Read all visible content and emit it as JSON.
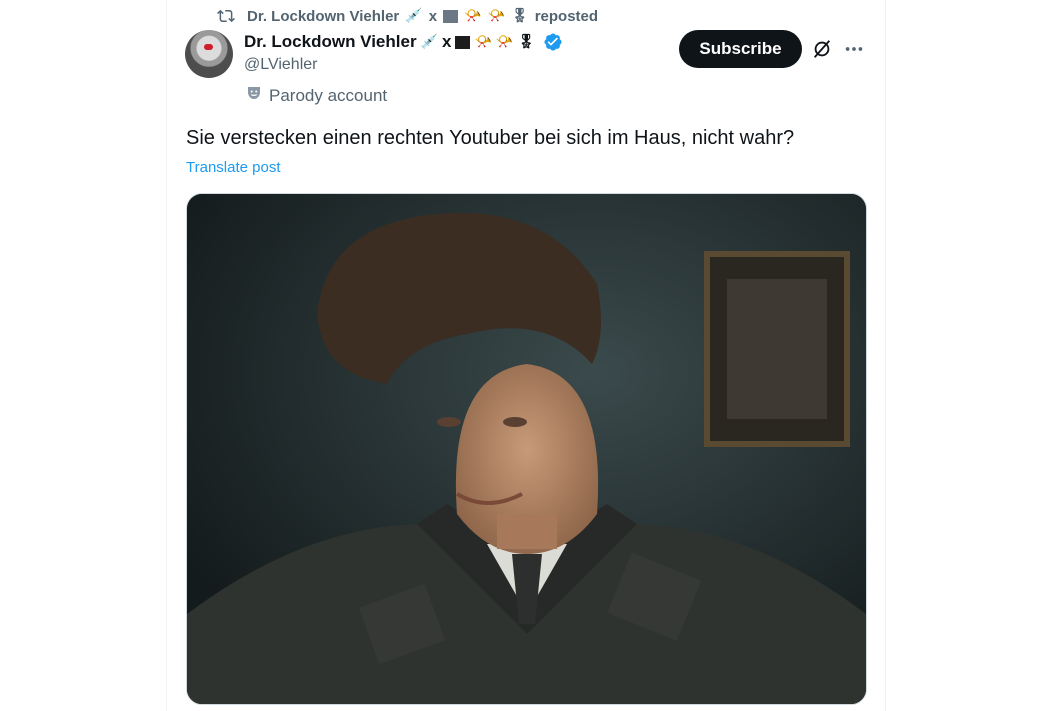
{
  "repost": {
    "author": "Dr. Lockdown Viehler",
    "suffix": "reposted",
    "icon": "repost-icon"
  },
  "author": {
    "name": "Dr. Lockdown Viehler",
    "x_letter": "x",
    "emoji_syringe": "💉",
    "emoji_horn": "📯",
    "emoji_medal": "🎖",
    "handle": "@LViehler",
    "label": "Parody account",
    "label_icon": "theater-mask-icon",
    "verified_icon": "verified-badge-icon"
  },
  "actions": {
    "subscribe": "Subscribe",
    "grok_icon": "grok-icon",
    "more_icon": "more-icon"
  },
  "post": {
    "text": "Sie verstecken einen rechten Youtuber bei sich im Haus, nicht wahr?",
    "translate": "Translate post"
  },
  "colors": {
    "text_primary": "#0f1419",
    "text_secondary": "#536471",
    "link": "#1d9bf0",
    "verified": "#1d9bf0",
    "button_bg": "#0f1419"
  }
}
